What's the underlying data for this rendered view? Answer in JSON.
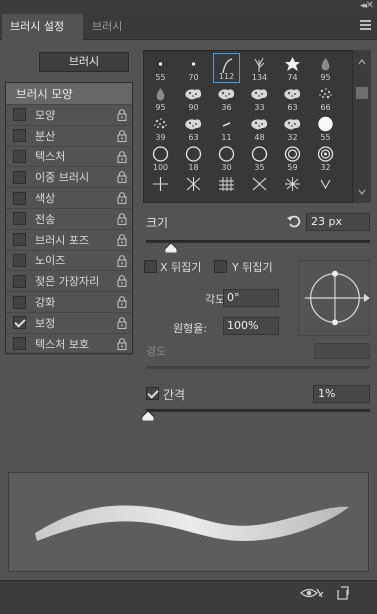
{
  "window": {
    "collapse_glyph": "◂◂",
    "close_glyph": "✕"
  },
  "tabs": [
    {
      "label": "브러시 설정"
    },
    {
      "label": "브러시"
    }
  ],
  "presets_button": "브러시",
  "options": {
    "header": "브러시 모양",
    "items": [
      {
        "label": "모양",
        "checked": false
      },
      {
        "label": "분산",
        "checked": false
      },
      {
        "label": "텍스처",
        "checked": false
      },
      {
        "label": "이중 브러시",
        "checked": false
      },
      {
        "label": "색상",
        "checked": false
      },
      {
        "label": "전송",
        "checked": false
      },
      {
        "label": "브러시 포즈",
        "checked": false
      },
      {
        "label": "노이즈",
        "checked": false
      },
      {
        "label": "젖은 가장자리",
        "checked": false
      },
      {
        "label": "강화",
        "checked": false
      },
      {
        "label": "보정",
        "checked": true
      },
      {
        "label": "텍스처 보호",
        "checked": false
      }
    ]
  },
  "brush_tips": [
    {
      "n": "55",
      "g": "dot"
    },
    {
      "n": "70",
      "g": "dot"
    },
    {
      "n": "112",
      "g": "stroke",
      "selected": true
    },
    {
      "n": "134",
      "g": "grass"
    },
    {
      "n": "74",
      "g": "leaf"
    },
    {
      "n": "95",
      "g": "drop"
    },
    {
      "n": "95",
      "g": "drop"
    },
    {
      "n": "90",
      "g": "splat"
    },
    {
      "n": "36",
      "g": "splat"
    },
    {
      "n": "33",
      "g": "splat"
    },
    {
      "n": "63",
      "g": "splat"
    },
    {
      "n": "66",
      "g": "spray"
    },
    {
      "n": "39",
      "g": "spray"
    },
    {
      "n": "63",
      "g": "splat"
    },
    {
      "n": "11",
      "g": "dash"
    },
    {
      "n": "48",
      "g": "splat"
    },
    {
      "n": "32",
      "g": "splat"
    },
    {
      "n": "55",
      "g": "disc"
    },
    {
      "n": "100",
      "g": "ring"
    },
    {
      "n": "18",
      "g": "ring"
    },
    {
      "n": "30",
      "g": "ring"
    },
    {
      "n": "35",
      "g": "ring"
    },
    {
      "n": "59",
      "g": "ring2"
    },
    {
      "n": "32",
      "g": "ring3"
    },
    {
      "n": "",
      "g": "cross"
    },
    {
      "n": "",
      "g": "cross2"
    },
    {
      "n": "",
      "g": "hash"
    },
    {
      "n": "",
      "g": "x"
    },
    {
      "n": "",
      "g": "star"
    },
    {
      "n": "",
      "g": "chev"
    }
  ],
  "size": {
    "label": "크기",
    "value": "23 px",
    "slider": 0.11
  },
  "flip": {
    "x_label": "X 뒤집기",
    "y_label": "Y 뒤집기",
    "x": false,
    "y": false
  },
  "angle": {
    "label": "각도:",
    "value": "0°"
  },
  "roundness": {
    "label": "원형율:",
    "value": "100%"
  },
  "hardness": {
    "label": "경도",
    "value": ""
  },
  "spacing": {
    "label": "간격",
    "value": "1%",
    "checked": true,
    "slider": 0.01
  },
  "icons": {
    "reset": "reset-icon",
    "eye": "preview-eye-icon",
    "new": "new-brush-icon",
    "lock": "lock-icon",
    "menu": "panel-menu-icon"
  }
}
